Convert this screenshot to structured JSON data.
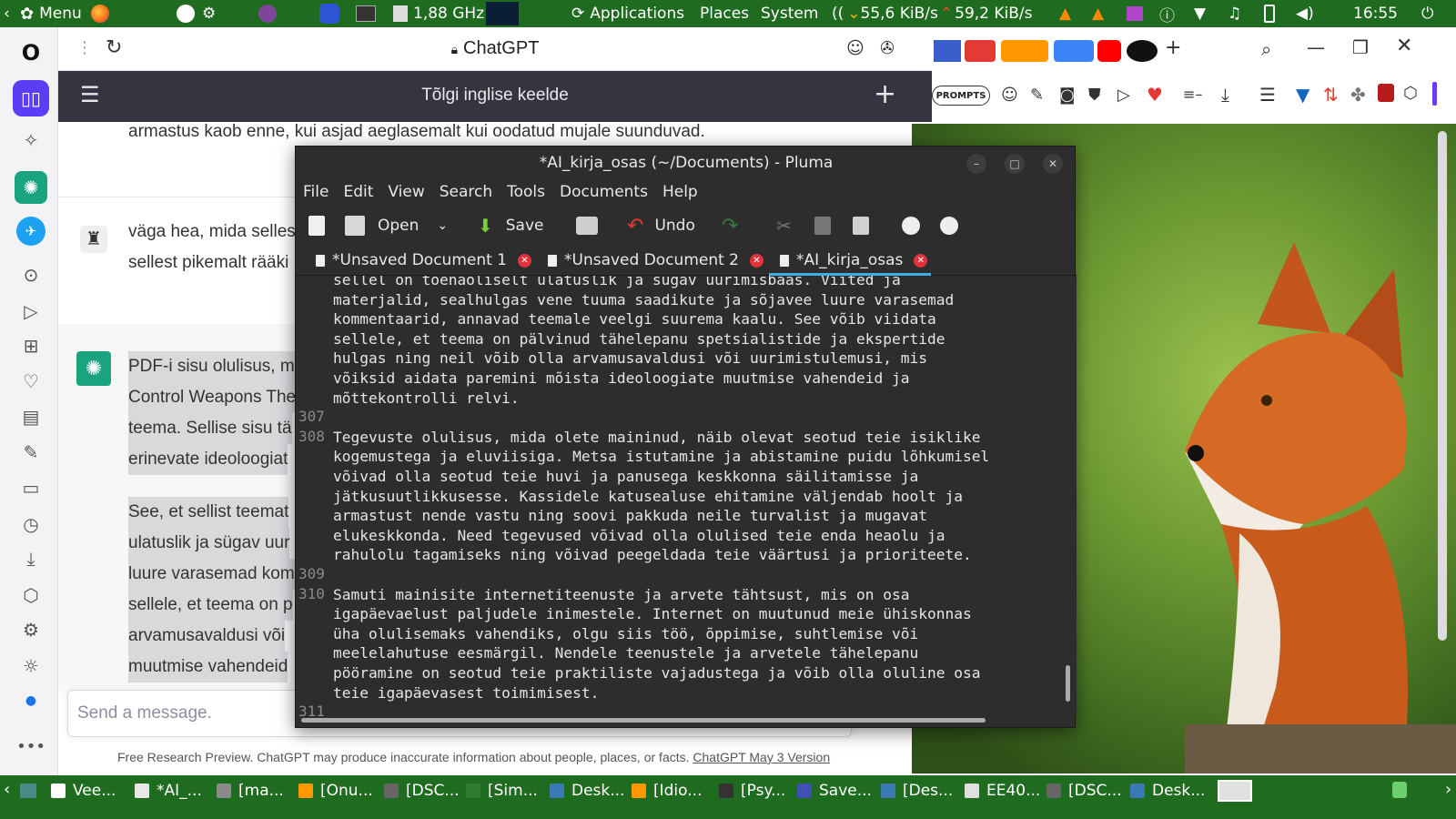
{
  "top_panel": {
    "menu_label": "Menu",
    "cpu_freq": "1,88 GHz",
    "applications": "Applications",
    "places": "Places",
    "system": "System",
    "net_down": "55,6 KiB/s",
    "net_up": "59,2 KiB/s",
    "clock": "16:55"
  },
  "browser": {
    "page_title": "ChatGPT",
    "prompts_label": "PROMPTS"
  },
  "chat": {
    "header_title": "Tõlgi inglise keelde",
    "line_top": "armastus kaob enne, kui asjad aeglasemalt kui oodatud mujale suunduvad.",
    "user_msg": [
      "väga hea, mida selles",
      "sellest pikemalt rääki"
    ],
    "assistant_p1": [
      "PDF-i sisu olulisus, m",
      "Control Weapons The",
      "teema. Sellise sisu tä",
      "erinevate ideoloogiat"
    ],
    "assistant_p2": [
      "See, et sellist teemat",
      "ulatuslik ja sügav uur",
      "luure varasemad kom",
      "sellele, et teema on p",
      "arvamusavaldusi või",
      "muutmise vahendeid"
    ],
    "input_placeholder": "Send a message.",
    "footer_text": "Free Research Preview. ChatGPT may produce inaccurate information about people, places, or facts.",
    "footer_link": "ChatGPT May 3 Version"
  },
  "pluma": {
    "title": "*AI_kirja_osas (~/Documents) - Pluma",
    "menus": [
      "File",
      "Edit",
      "View",
      "Search",
      "Tools",
      "Documents",
      "Help"
    ],
    "toolbar": {
      "open": "Open",
      "save": "Save",
      "undo": "Undo"
    },
    "tabs": [
      "*Unsaved Document 1",
      "*Unsaved Document 2",
      "*AI_kirja_osas"
    ],
    "lines": [
      {
        "num": "",
        "text": "sellel on tõenäoliselt ulatuslik ja sügav uurimisbaas. Viited ja"
      },
      {
        "num": "",
        "text": "materjalid, sealhulgas vene tuuma saadikute ja sõjavee luure varasemad"
      },
      {
        "num": "",
        "text": "kommentaarid, annavad teemale veelgi suurema kaalu. See võib viidata"
      },
      {
        "num": "",
        "text": "sellele, et teema on pälvinud tähelepanu spetsialistide ja ekspertide"
      },
      {
        "num": "",
        "text": "hulgas ning neil võib olla arvamusavaldusi või uurimistulemusi, mis"
      },
      {
        "num": "",
        "text": "võiksid aidata paremini mõista ideoloogiate muutmise vahendeid ja"
      },
      {
        "num": "",
        "text": "mõttekontrolli relvi."
      },
      {
        "num": "307",
        "text": ""
      },
      {
        "num": "308",
        "text": "Tegevuste olulisus, mida olete maininud, näib olevat seotud teie isiklike"
      },
      {
        "num": "",
        "text": "kogemustega ja eluviisiga. Metsa istutamine ja abistamine puidu lõhkumisel"
      },
      {
        "num": "",
        "text": "võivad olla seotud teie huvi ja panusega keskkonna säilitamisse ja"
      },
      {
        "num": "",
        "text": "jätkusuutlikkusesse. Kassidele katusealuse ehitamine väljendab hoolt ja"
      },
      {
        "num": "",
        "text": "armastust nende vastu ning soovi pakkuda neile turvalist ja mugavat"
      },
      {
        "num": "",
        "text": "elukeskkonda. Need tegevused võivad olla olulised teie enda heaolu ja"
      },
      {
        "num": "",
        "text": "rahulolu tagamiseks ning võivad peegeldada teie väärtusi ja prioriteete."
      },
      {
        "num": "309",
        "text": ""
      },
      {
        "num": "310",
        "text": "Samuti mainisite internetiteenuste ja arvete tähtsust, mis on osa"
      },
      {
        "num": "",
        "text": "igapäevaelust paljudele inimestele. Internet on muutunud meie ühiskonnas"
      },
      {
        "num": "",
        "text": "üha olulisemaks vahendiks, olgu siis töö, õppimise, suhtlemise või"
      },
      {
        "num": "",
        "text": "meelelahutuse eesmärgil. Nendele teenustele ja arvetele tähelepanu"
      },
      {
        "num": "",
        "text": "pööramine on seotud teie praktiliste vajadustega ja võib olla oluline osa"
      },
      {
        "num": "",
        "text": "teie igapäevasest toimimisest."
      },
      {
        "num": "311",
        "text": ""
      }
    ]
  },
  "taskbar": [
    "Vee...",
    "*AI_...",
    "[ma...",
    "[Onu...",
    "[DSC...",
    "[Sim...",
    "Desk...",
    "[Idio...",
    "[Psy...",
    "Save...",
    "[Des...",
    "EE40...",
    "[DSC...",
    "Desk..."
  ]
}
